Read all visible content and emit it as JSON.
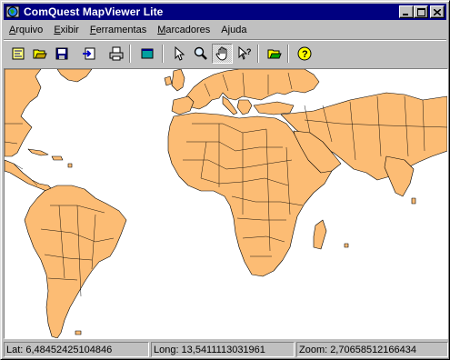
{
  "window": {
    "title": "ComQuest MapViewer Lite"
  },
  "menu": {
    "items": [
      {
        "key": "A",
        "rest": "rquivo"
      },
      {
        "key": "E",
        "rest": "xibir"
      },
      {
        "key": "F",
        "rest": "erramentas"
      },
      {
        "key": "M",
        "rest": "arcadores"
      },
      {
        "key": "A",
        "rest": "juda",
        "pre": ""
      }
    ]
  },
  "toolbar": {
    "buttons": [
      "new-map",
      "open",
      "save",
      "export",
      "print",
      "full-extent",
      "select",
      "zoom",
      "pan",
      "query",
      "open-layer",
      "help"
    ],
    "active": "pan"
  },
  "map": {
    "land_color": "#fcbc74",
    "border_color": "#000000",
    "sea_color": "#ffffff"
  },
  "status": {
    "lat_label": "Lat:",
    "lat_value": "6,48452425104846",
    "long_label": "Long:",
    "long_value": "13,5411113031961",
    "zoom_label": "Zoom:",
    "zoom_value": "2,70658512166434"
  }
}
